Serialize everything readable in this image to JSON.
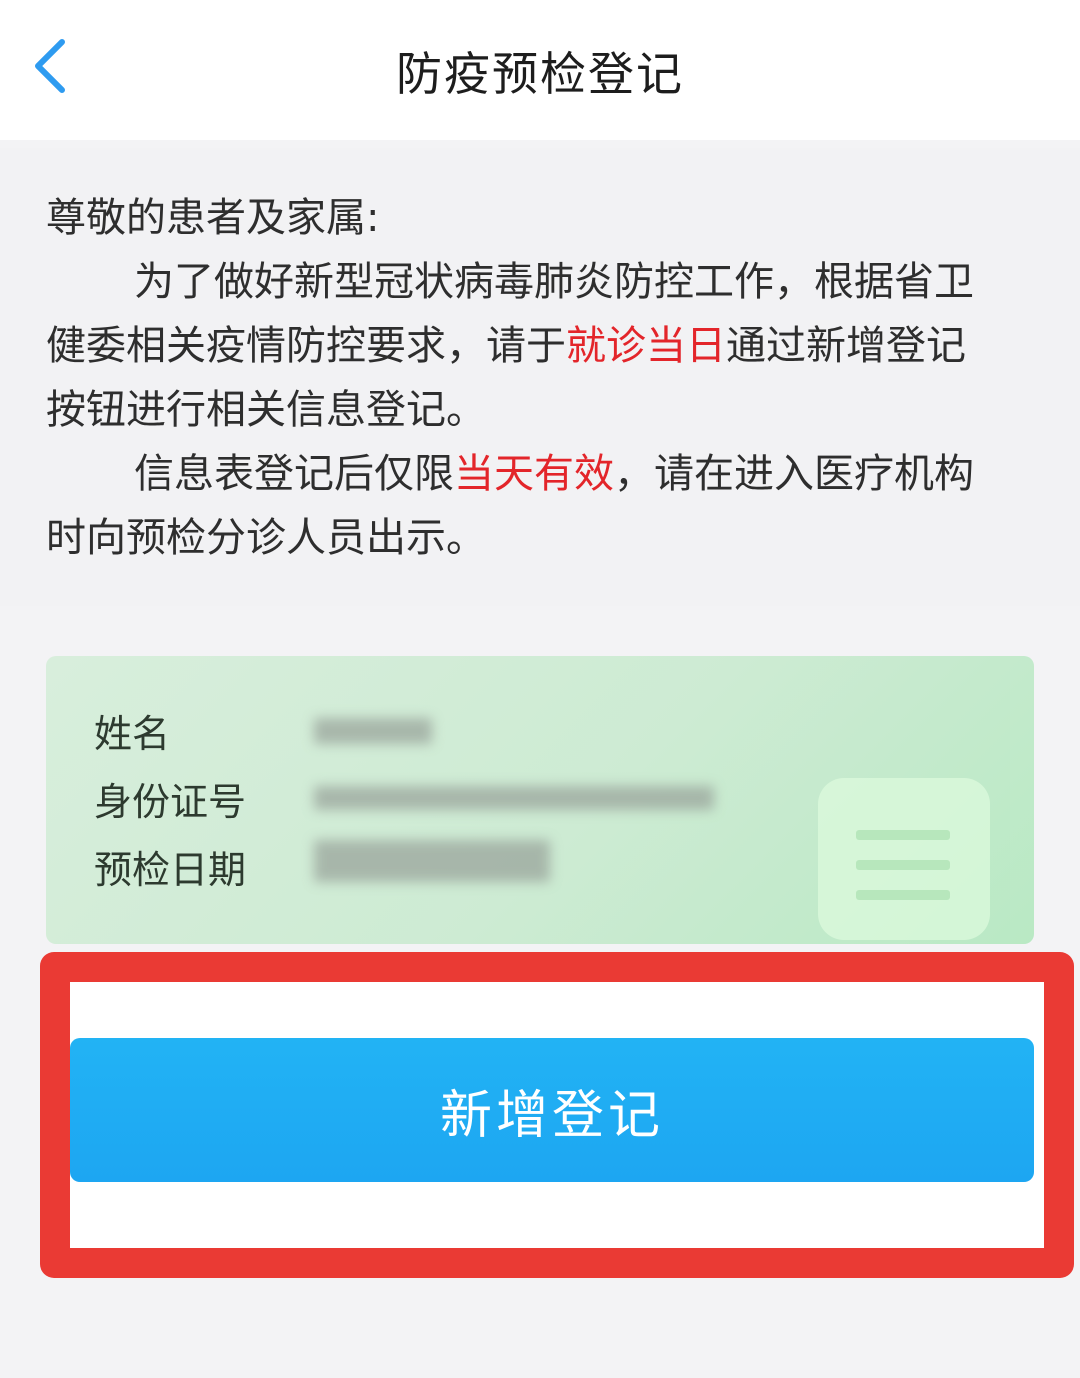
{
  "header": {
    "title": "防疫预检登记"
  },
  "notice": {
    "greeting": "尊敬的患者及家属:",
    "para1_before": "为了做好新型冠状病毒肺炎防控工作，根据省卫健委相关疫情防控要求，请于",
    "para1_highlight": "就诊当日",
    "para1_after": "通过新增登记按钮进行相关信息登记。",
    "para2_before": "信息表登记后仅限",
    "para2_highlight": "当天有效",
    "para2_after": "，请在进入医疗机构时向预检分诊人员出示。",
    "highlight_color": "#e3252a"
  },
  "card": {
    "labels": [
      "姓名",
      "身份证号",
      "预检日期"
    ]
  },
  "actions": {
    "add_label": "新增登记",
    "button_color": "#1da6f2",
    "outline_color": "#ea3a34"
  }
}
